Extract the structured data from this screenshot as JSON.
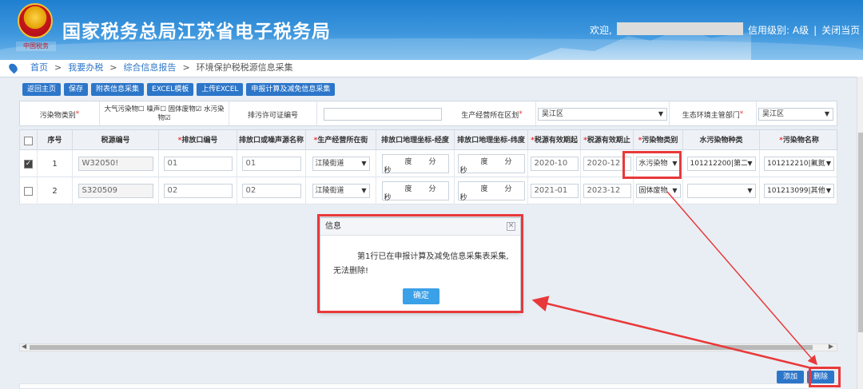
{
  "header": {
    "site_title": "国家税务总局江苏省电子税务局",
    "emblem_caption": "中国税务",
    "welcome": "欢迎,",
    "credit_level": "信用级别: A级",
    "separator": "|",
    "close_page": "关闭当页"
  },
  "breadcrumb": {
    "items": [
      "首页",
      ">",
      "我要办税",
      ">",
      "综合信息报告",
      ">",
      "环境保护税税源信息采集"
    ]
  },
  "toolbar": {
    "buttons": [
      "返回主页",
      "保存",
      "附表信息采集",
      "EXCEL模板",
      "上传EXCEL",
      "申报计算及减免信息采集"
    ]
  },
  "filter": {
    "pollutant_type_label": "污染物类别",
    "pollutant_options": "大气污染物☐ 噪声☐ 固体废物☑ 水污染物☑",
    "permit_label": "排污许可证编号",
    "permit_value": "",
    "district_label": "生产经营所在区划",
    "district_value": "吴江区",
    "authority_label": "生态环境主管部门",
    "authority_value": "吴江区"
  },
  "grid": {
    "headers": [
      "序号",
      "税源编号",
      "排放口编号",
      "排放口或噪声源名称",
      "生产经营所在街",
      "排放口地理坐标-经度",
      "排放口地理坐标-纬度",
      "税源有效期起",
      "税源有效期止",
      "污染物类别",
      "水污染物种类",
      "污染物名称"
    ],
    "required_mark": "*",
    "coord_labels": {
      "deg": "度",
      "min": "分",
      "sec": "秒"
    },
    "rows": [
      {
        "no": "1",
        "checked": true,
        "source_id": "W32050!",
        "outlet_no": "01",
        "outlet_name": "01",
        "street": "江陵街道",
        "start": "2020-10",
        "end": "2020-12",
        "pollutant_type": "水污染物",
        "water_kind": "101212200|第二",
        "pollutant_name": "101212210|氟氮"
      },
      {
        "no": "2",
        "checked": false,
        "source_id": "S320509",
        "outlet_no": "02",
        "outlet_name": "02",
        "street": "江陵街道",
        "start": "2021-01",
        "end": "2023-12",
        "pollutant_type": "固体废物",
        "water_kind": "",
        "pollutant_name": "101213099|其他"
      }
    ]
  },
  "bottom": {
    "add": "添加",
    "delete": "删除"
  },
  "modal": {
    "title": "信息",
    "close": "✕",
    "message_line1": "第1行已在申报计算及减免信息采集表采集,",
    "message_line2": "无法删除!",
    "ok": "确定"
  },
  "colors": {
    "brand_blue": "#2c76c9",
    "highlight_red": "#e8393a"
  }
}
